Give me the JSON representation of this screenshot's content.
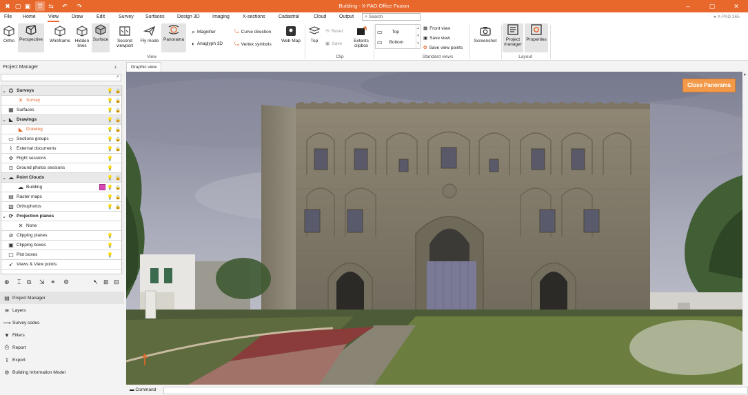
{
  "titlebar": {
    "title": "Building - X-PAD Office Fusion",
    "quick_access": [
      "app-logo-icon",
      "new-icon",
      "open-icon",
      "save-icon",
      "layers-active-icon",
      "flip-icon",
      "undo-icon",
      "redo-icon"
    ],
    "window_buttons": [
      "–",
      "▢",
      "✕"
    ]
  },
  "menu": {
    "items": [
      "File",
      "Home",
      "View",
      "Draw",
      "Edit",
      "Survey",
      "Surfaces",
      "Design 3D",
      "Imaging",
      "X-sections",
      "Cadastral",
      "Cloud",
      "Output"
    ],
    "active": "View",
    "search_placeholder": "Search",
    "user_badge": "X-PAD 365"
  },
  "ribbon": {
    "view_group": {
      "label": "View",
      "buttons": [
        "Ortho",
        "Perspective",
        "Wireframe",
        "Hidden lines",
        "Surface",
        "Second viewport",
        "Fly mode",
        "Panorama"
      ],
      "selected": [
        "Perspective",
        "Surface",
        "Panorama"
      ],
      "small": [
        "Magnifier",
        "Anaglyph 3D",
        "Curve direction",
        "Vertex symbols",
        "Web Map"
      ]
    },
    "clip_group": {
      "label": "Clip",
      "top": "Top",
      "reset": "Reset",
      "save": "Save",
      "extents": "Extents clipbox"
    },
    "standard_views": {
      "label": "Standard views",
      "top": "Top",
      "bottom": "Bottom",
      "front": "Front view",
      "save_view": "Save view",
      "save_view_points": "Save view points"
    },
    "screenshot": "Screenshot",
    "layout_group": {
      "label": "Layout",
      "project_manager": "Project manager",
      "properties": "Properties"
    }
  },
  "project_manager": {
    "title": "Project Manager",
    "tree": [
      {
        "label": "Surveys",
        "kind": "group",
        "icon": "surveys-icon",
        "bulb": true,
        "lock": true
      },
      {
        "label": "Survey",
        "kind": "child-orange",
        "icon": "survey-icon",
        "bulb": true,
        "lock": true
      },
      {
        "label": "Surfaces",
        "kind": "item",
        "icon": "surfaces-icon",
        "bulb": true,
        "lock": true
      },
      {
        "label": "Drawings",
        "kind": "group",
        "icon": "drawings-icon",
        "bulb": true,
        "lock": true
      },
      {
        "label": "Drawing",
        "kind": "child-orange",
        "icon": "drawing-icon",
        "bulb": true,
        "lock": true
      },
      {
        "label": "Sections groups",
        "kind": "item",
        "icon": "sections-icon",
        "bulb": true,
        "lock": true
      },
      {
        "label": "External documents",
        "kind": "item",
        "icon": "attachment-icon",
        "bulb": true,
        "lock": true
      },
      {
        "label": "Flight sessions",
        "kind": "item",
        "icon": "drone-icon",
        "bulb": true,
        "lock": false
      },
      {
        "label": "Ground photos sessions",
        "kind": "item",
        "icon": "camera-icon",
        "bulb": true,
        "lock": false
      },
      {
        "label": "Point Clouds",
        "kind": "group",
        "icon": "point-cloud-icon",
        "bulb": true,
        "lock": true
      },
      {
        "label": "Building",
        "kind": "child",
        "icon": "cloud-icon",
        "bulb": true,
        "lock": true,
        "swatch": "#d946b4"
      },
      {
        "label": "Raster maps",
        "kind": "item",
        "icon": "raster-icon",
        "bulb": true,
        "lock": true
      },
      {
        "label": "Orthophotos",
        "kind": "item",
        "icon": "orthophoto-icon",
        "bulb": true,
        "lock": true
      },
      {
        "label": "Projection planes",
        "kind": "group",
        "icon": "projection-icon",
        "bulb": false,
        "lock": false
      },
      {
        "label": "None",
        "kind": "child",
        "icon": "none-icon",
        "bulb": false,
        "lock": false
      },
      {
        "label": "Clipping planes",
        "kind": "item",
        "icon": "clip-plane-icon",
        "bulb": true,
        "lock": false
      },
      {
        "label": "Clipping boxes",
        "kind": "item",
        "icon": "clip-box-icon",
        "bulb": true,
        "lock": false
      },
      {
        "label": "Plot boxes",
        "kind": "item",
        "icon": "plot-box-icon",
        "bulb": true,
        "lock": false
      },
      {
        "label": "Views & View points",
        "kind": "item",
        "icon": "views-icon",
        "bulb": false,
        "lock": false
      }
    ],
    "nav": [
      "Project Manager",
      "Layers",
      "Survey codes",
      "Filters",
      "Report",
      "Export",
      "Building Information Model"
    ],
    "nav_selected": "Project Manager"
  },
  "graphic_view": {
    "tab": "Graphic view",
    "close_panorama": "Close Panorama"
  },
  "command": {
    "label": "Command"
  }
}
